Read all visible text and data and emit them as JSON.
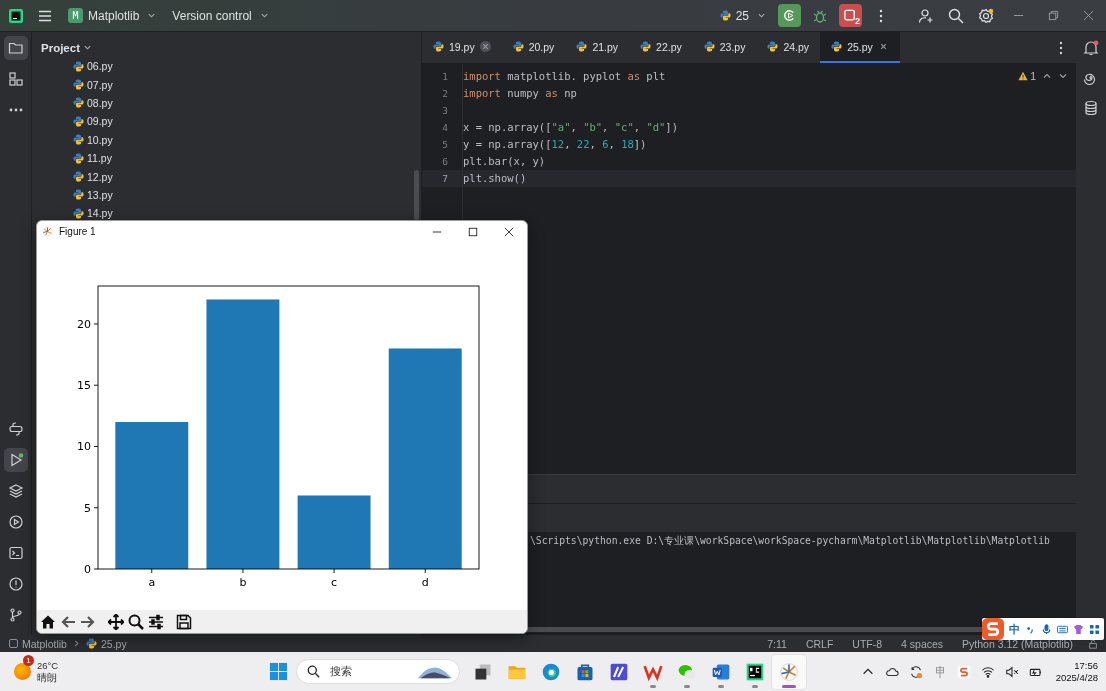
{
  "title_bar": {
    "project_badge": "M",
    "project": "Matplotlib",
    "vcs": "Version control",
    "run_config": "25",
    "stop_count": "2"
  },
  "tool_strip": {
    "top": [
      {
        "kind": "folder",
        "selected": true
      },
      {
        "kind": "structure",
        "selected": false
      },
      {
        "kind": "more",
        "selected": false
      }
    ],
    "bottom": [
      {
        "kind": "python",
        "selected": false
      },
      {
        "kind": "run",
        "selected": true
      },
      {
        "kind": "layers",
        "selected": false
      },
      {
        "kind": "services",
        "selected": false
      },
      {
        "kind": "terminal",
        "selected": false
      },
      {
        "kind": "problems",
        "selected": false
      },
      {
        "kind": "git",
        "selected": false
      }
    ]
  },
  "project_panel": {
    "title": "Project",
    "files": [
      {
        "name": "06.py"
      },
      {
        "name": "07.py"
      },
      {
        "name": "08.py"
      },
      {
        "name": "09.py"
      },
      {
        "name": "10.py"
      },
      {
        "name": "11.py"
      },
      {
        "name": "12.py"
      },
      {
        "name": "13.py"
      },
      {
        "name": "14.py"
      }
    ]
  },
  "tabs": [
    {
      "label": "19.py",
      "selected": false,
      "close_shown": true
    },
    {
      "label": "20.py",
      "selected": false,
      "close_shown": false
    },
    {
      "label": "21.py",
      "selected": false,
      "close_shown": false
    },
    {
      "label": "22.py",
      "selected": false,
      "close_shown": false
    },
    {
      "label": "23.py",
      "selected": false,
      "close_shown": false
    },
    {
      "label": "24.py",
      "selected": false,
      "close_shown": false
    },
    {
      "label": "25.py",
      "selected": true,
      "close_shown": true
    }
  ],
  "editor": {
    "warnings": "1",
    "lines": [
      {
        "number": "1",
        "current": false,
        "tokens": [
          {
            "kind": "keyword",
            "text": "import"
          },
          {
            "kind": "plain",
            "text": " matplotlib. pyplot "
          },
          {
            "kind": "keyword",
            "text": "as"
          },
          {
            "kind": "plain",
            "text": " plt"
          }
        ]
      },
      {
        "number": "2",
        "current": false,
        "tokens": [
          {
            "kind": "keyword",
            "text": "import"
          },
          {
            "kind": "plain",
            "text": " numpy "
          },
          {
            "kind": "keyword",
            "text": "as"
          },
          {
            "kind": "plain",
            "text": " np"
          }
        ]
      },
      {
        "number": "3",
        "current": false
      },
      {
        "number": "4",
        "current": false,
        "tokens": [
          {
            "kind": "plain",
            "text": "x = np.array(["
          },
          {
            "kind": "string",
            "text": "\"a\""
          },
          {
            "kind": "plain",
            "text": ", "
          },
          {
            "kind": "string",
            "text": "\"b\""
          },
          {
            "kind": "plain",
            "text": ", "
          },
          {
            "kind": "string",
            "text": "\"c\""
          },
          {
            "kind": "plain",
            "text": ", "
          },
          {
            "kind": "string",
            "text": "\"d\""
          },
          {
            "kind": "plain",
            "text": "])"
          }
        ]
      },
      {
        "number": "5",
        "current": false,
        "tokens": [
          {
            "kind": "plain",
            "text": "y = np.array(["
          },
          {
            "kind": "number",
            "text": "12"
          },
          {
            "kind": "plain",
            "text": ", "
          },
          {
            "kind": "number",
            "text": "22"
          },
          {
            "kind": "plain",
            "text": ", "
          },
          {
            "kind": "number",
            "text": "6"
          },
          {
            "kind": "plain",
            "text": ", "
          },
          {
            "kind": "number",
            "text": "18"
          },
          {
            "kind": "plain",
            "text": "])"
          }
        ]
      },
      {
        "number": "6",
        "current": false,
        "tokens": [
          {
            "kind": "plain",
            "text": "plt.bar(x, y)"
          }
        ]
      },
      {
        "number": "7",
        "current": true,
        "tokens": [
          {
            "kind": "plain",
            "text": "plt.show()"
          }
        ]
      }
    ]
  },
  "terminal": {
    "command": "\\Scripts\\python.exe D:\\专业课\\workSpace\\workSpace-pycharm\\Matplotlib\\Matplotlib\\Matplotlib"
  },
  "figure": {
    "title": "Figure 1",
    "chart_data": {
      "type": "bar",
      "categories": [
        "a",
        "b",
        "c",
        "d"
      ],
      "series": [
        {
          "color": "#1f77b4",
          "values": [
            12,
            22,
            6,
            18
          ]
        }
      ],
      "ylim": [
        0,
        23.1
      ],
      "yticks": [
        0,
        5,
        10,
        15,
        20
      ]
    }
  },
  "status_bar": {
    "breadcrumb": [
      "Matplotlib",
      "25.py"
    ],
    "items": [
      "7:11",
      "CRLF",
      "UTF-8",
      "4 spaces",
      "Python 3.12 (Matplotlib)"
    ]
  },
  "ime_bar": {
    "mode": "中"
  },
  "taskbar": {
    "weather": {
      "badge": "1",
      "temperature": "26°C",
      "condition": "晴朗"
    },
    "search": {
      "placeholder": "搜索"
    },
    "apps": [
      {
        "kind": "taskview",
        "running": false,
        "selected": false
      },
      {
        "kind": "explorer",
        "running": false,
        "selected": false
      },
      {
        "kind": "edge",
        "running": false,
        "selected": false
      },
      {
        "kind": "store",
        "running": false,
        "selected": false
      },
      {
        "kind": "notes",
        "running": false,
        "selected": false
      },
      {
        "kind": "wps",
        "running": true,
        "selected": false
      },
      {
        "kind": "wechat",
        "running": true,
        "selected": false
      },
      {
        "kind": "word",
        "running": true,
        "selected": false
      },
      {
        "kind": "pycharm",
        "running": true,
        "selected": false
      },
      {
        "kind": "plot",
        "running": true,
        "selected": true
      }
    ],
    "clock": {
      "time": "17:56",
      "date": "2025/4/28"
    }
  }
}
